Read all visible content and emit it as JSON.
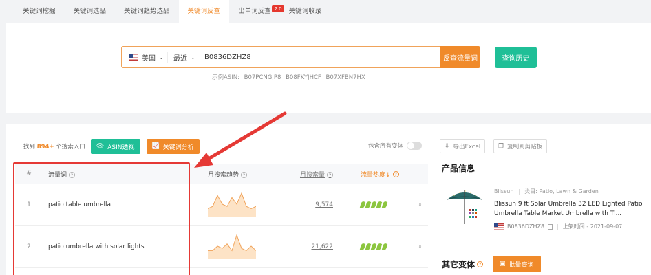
{
  "tabs": [
    {
      "label": "关键词挖掘"
    },
    {
      "label": "关键词选品"
    },
    {
      "label": "关键词趋势选品"
    },
    {
      "label": "关键词反查"
    },
    {
      "label": "出单词反查",
      "badge": "2.0"
    },
    {
      "label": "关键词收录"
    }
  ],
  "search": {
    "country": "美国",
    "period": "最近",
    "asin": "B0836DZHZ8",
    "submit_label": "反查流量词",
    "history_label": "查询历史",
    "examples_label": "示例ASIN:",
    "examples": [
      "B07PCNGJP8",
      "B08FKYJHCF",
      "B07XFBN7HX"
    ]
  },
  "results": {
    "found_prefix": "找到",
    "found_count": "894+",
    "found_suffix": "个搜索入口",
    "asin_view_label": "ASIN透视",
    "keyword_analysis_label": "关键词分析",
    "variants_label": "包含所有变体",
    "export_label": "导出Excel",
    "copy_label": "复制到剪贴板",
    "columns": {
      "num": "#",
      "keyword": "流量词",
      "trend": "月搜索趋势",
      "volume": "月搜索量",
      "heat": "流量热度↓"
    },
    "rows": [
      {
        "num": "1",
        "keyword": "patio table umbrella",
        "volume": "9,574",
        "trend": [
          3,
          4,
          9,
          5,
          4,
          8,
          5,
          10,
          4,
          3,
          4
        ]
      },
      {
        "num": "2",
        "keyword": "patio umbrella with solar lights",
        "volume": "21,622",
        "trend": [
          3,
          3,
          5,
          4,
          6,
          3,
          10,
          4,
          3,
          5,
          3
        ]
      }
    ]
  },
  "product": {
    "section_title": "产品信息",
    "brand": "Blissun",
    "category_label": "类目: Patio, Lawn & Garden",
    "title": "Blissun 9 ft Solar Umbrella 32 LED Lighted Patio Umbrella Table Market Umbrella with Ti...",
    "asin": "B0836DZHZ8",
    "listed": "上架时间 - 2021-09-07"
  },
  "variants_section": {
    "title": "其它变体",
    "batch_label": "批量查询"
  },
  "colors": {
    "accent_orange": "#f08a2a",
    "accent_green": "#1fbf97",
    "highlight_red": "#e53935"
  }
}
